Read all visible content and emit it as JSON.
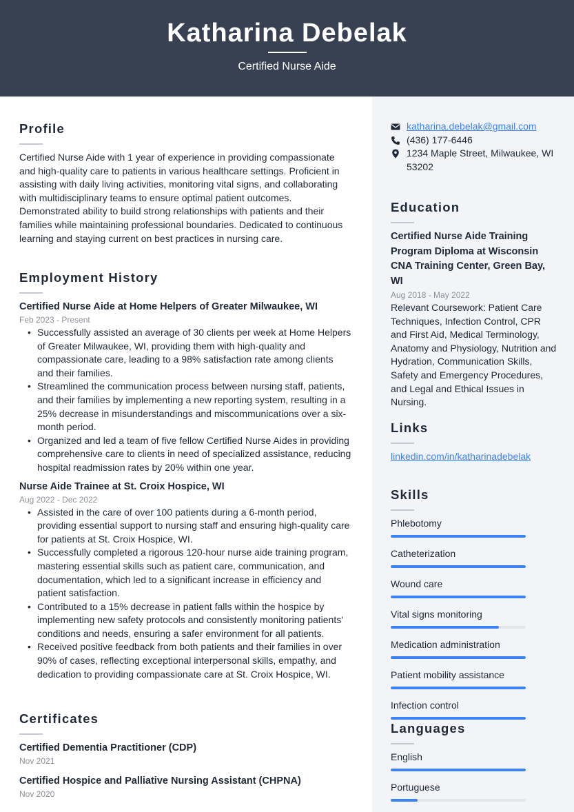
{
  "header": {
    "name": "Katharina Debelak",
    "title": "Certified Nurse Aide"
  },
  "profile": {
    "heading": "Profile",
    "text": "Certified Nurse Aide with 1 year of experience in providing compassionate and high-quality care to patients in various healthcare settings. Proficient in assisting with daily living activities, monitoring vital signs, and collaborating with multidisciplinary teams to ensure optimal patient outcomes. Demonstrated ability to build strong relationships with patients and their families while maintaining professional boundaries. Dedicated to continuous learning and staying current on best practices in nursing care."
  },
  "employment": {
    "heading": "Employment History",
    "jobs": [
      {
        "title": "Certified Nurse Aide at Home Helpers of Greater Milwaukee, WI",
        "dates": "Feb 2023 - Present",
        "bullets": [
          "Successfully assisted an average of 30 clients per week at Home Helpers of Greater Milwaukee, WI, providing them with high-quality and compassionate care, leading to a 98% satisfaction rate among clients and their families.",
          "Streamlined the communication process between nursing staff, patients, and their families by implementing a new reporting system, resulting in a 25% decrease in misunderstandings and miscommunications over a six-month period.",
          "Organized and led a team of five fellow Certified Nurse Aides in providing comprehensive care to clients in need of specialized assistance, reducing hospital readmission rates by 20% within one year."
        ]
      },
      {
        "title": "Nurse Aide Trainee at St. Croix Hospice, WI",
        "dates": "Aug 2022 - Dec 2022",
        "bullets": [
          "Assisted in the care of over 100 patients during a 6-month period, providing essential support to nursing staff and ensuring high-quality care for patients at St. Croix Hospice, WI.",
          "Successfully completed a rigorous 120-hour nurse aide training program, mastering essential skills such as patient care, communication, and documentation, which led to a significant increase in efficiency and patient satisfaction.",
          "Contributed to a 15% decrease in patient falls within the hospice by implementing new safety protocols and consistently monitoring patients' conditions and needs, ensuring a safer environment for all patients.",
          "Received positive feedback from both patients and their families in over 90% of cases, reflecting exceptional interpersonal skills, empathy, and dedication to providing compassionate care at St. Croix Hospice, WI."
        ]
      }
    ]
  },
  "certificates": {
    "heading": "Certificates",
    "items": [
      {
        "name": "Certified Dementia Practitioner (CDP)",
        "date": "Nov 2021"
      },
      {
        "name": "Certified Hospice and Palliative Nursing Assistant (CHPNA)",
        "date": "Nov 2020"
      }
    ]
  },
  "contact": {
    "email": "katharina.debelak@gmail.com",
    "phone": "(436) 177-6446",
    "address": "1234 Maple Street, Milwaukee, WI 53202",
    "icons": {
      "email": "envelope-icon",
      "phone": "phone-icon",
      "address": "map-pin-icon"
    }
  },
  "education": {
    "heading": "Education",
    "degree": "Certified Nurse Aide Training Program Diploma at Wisconsin CNA Training Center, Green Bay, WI",
    "dates": "Aug 2018 - May 2022",
    "description": "Relevant Coursework: Patient Care Techniques, Infection Control, CPR and First Aid, Medical Terminology, Anatomy and Physiology, Nutrition and Hydration, Communication Skills, Safety and Emergency Procedures, and Legal and Ethical Issues in Nursing."
  },
  "links": {
    "heading": "Links",
    "items": [
      "linkedin.com/in/katharinadebelak"
    ]
  },
  "skills": {
    "heading": "Skills",
    "items": [
      {
        "name": "Phlebotomy",
        "level": 100
      },
      {
        "name": "Catheterization",
        "level": 100
      },
      {
        "name": "Wound care",
        "level": 100
      },
      {
        "name": "Vital signs monitoring",
        "level": 80
      },
      {
        "name": "Medication administration",
        "level": 100
      },
      {
        "name": "Patient mobility assistance",
        "level": 100
      },
      {
        "name": "Infection control",
        "level": 100
      }
    ]
  },
  "languages": {
    "heading": "Languages",
    "items": [
      {
        "name": "English",
        "level": 100
      },
      {
        "name": "Portuguese",
        "level": 20
      }
    ]
  },
  "colors": {
    "header_bg": "#374151",
    "sidebar_bg": "#f2f4f7",
    "accent": "#3b82f6",
    "muted": "#8b9097"
  }
}
